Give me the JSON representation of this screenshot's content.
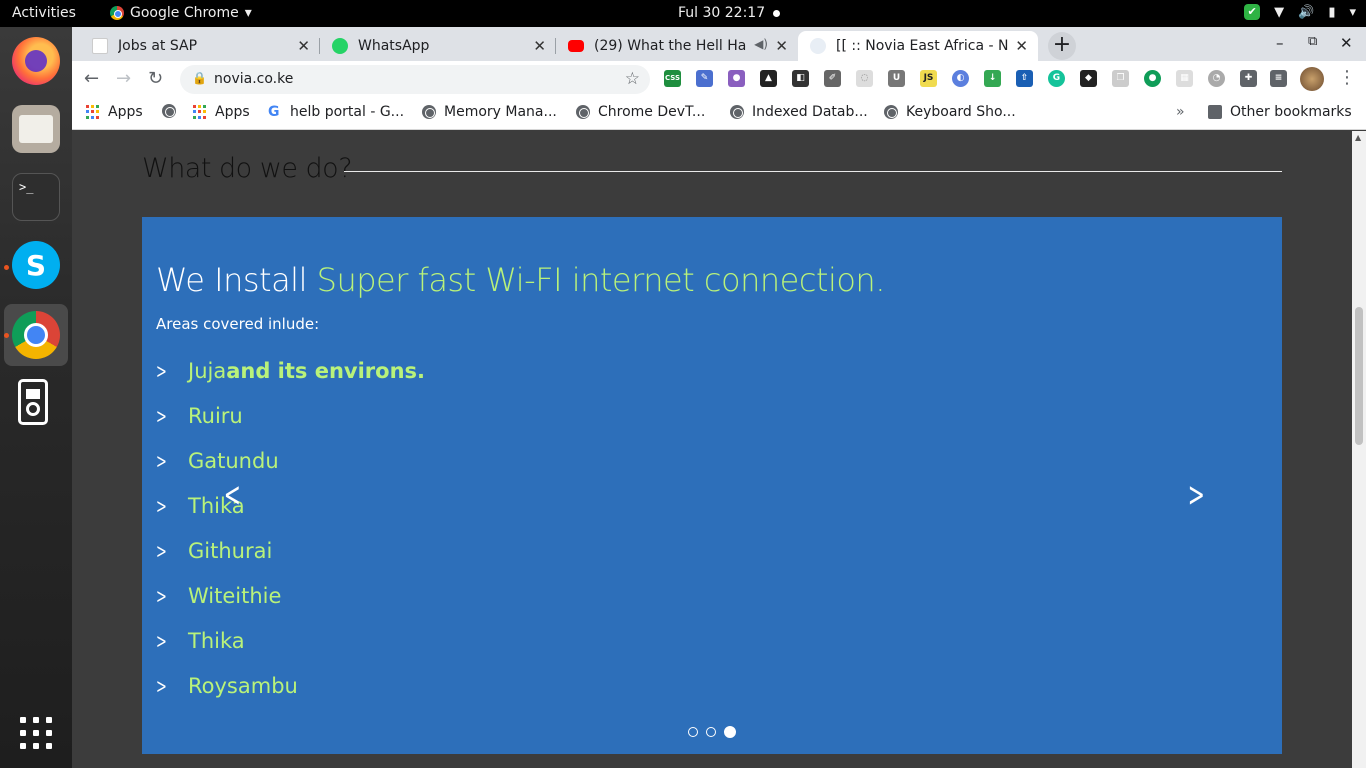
{
  "topbar": {
    "activities": "Activities",
    "app_menu": "Google Chrome",
    "clock": "Ful 30  22:17"
  },
  "tabs": [
    {
      "title": "Jobs at SAP"
    },
    {
      "title": "WhatsApp"
    },
    {
      "title": "(29) What the Hell Hap"
    },
    {
      "title": "[[ :: Novia East Africa - No"
    }
  ],
  "toolbar": {
    "url": "novia.co.ke",
    "extension_labels": {
      "css": "CSS",
      "u": "U",
      "js": "JS"
    }
  },
  "bookmarks": [
    {
      "label": "Apps"
    },
    {
      "label": "Apps"
    },
    {
      "label": "helb portal - G..."
    },
    {
      "label": "Memory Mana..."
    },
    {
      "label": "Chrome DevT..."
    },
    {
      "label": "Indexed Datab..."
    },
    {
      "label": "Keyboard Sho..."
    },
    {
      "label": "Other bookmarks"
    }
  ],
  "page": {
    "section_title": "What do we do?",
    "slide": {
      "heading_prefix": "We Install ",
      "heading_highlight": "Super fast Wi-FI internet connection.",
      "areas_label": "Areas covered inlude:",
      "areas": [
        {
          "name": "Juja",
          "rest": " and its environs."
        },
        {
          "name": "Ruiru",
          "rest": ""
        },
        {
          "name": "Gatundu",
          "rest": ""
        },
        {
          "name": "Thika",
          "rest": ""
        },
        {
          "name": "Githurai",
          "rest": ""
        },
        {
          "name": "Witeithie",
          "rest": ""
        },
        {
          "name": "Thika",
          "rest": ""
        },
        {
          "name": "Roysambu",
          "rest": ""
        }
      ],
      "indicator_count": 3,
      "active_indicator": 3
    }
  },
  "colors": {
    "carousel_bg": "#2d6fba",
    "highlight": "#b9f27a",
    "page_bg": "#3c3c3c"
  }
}
